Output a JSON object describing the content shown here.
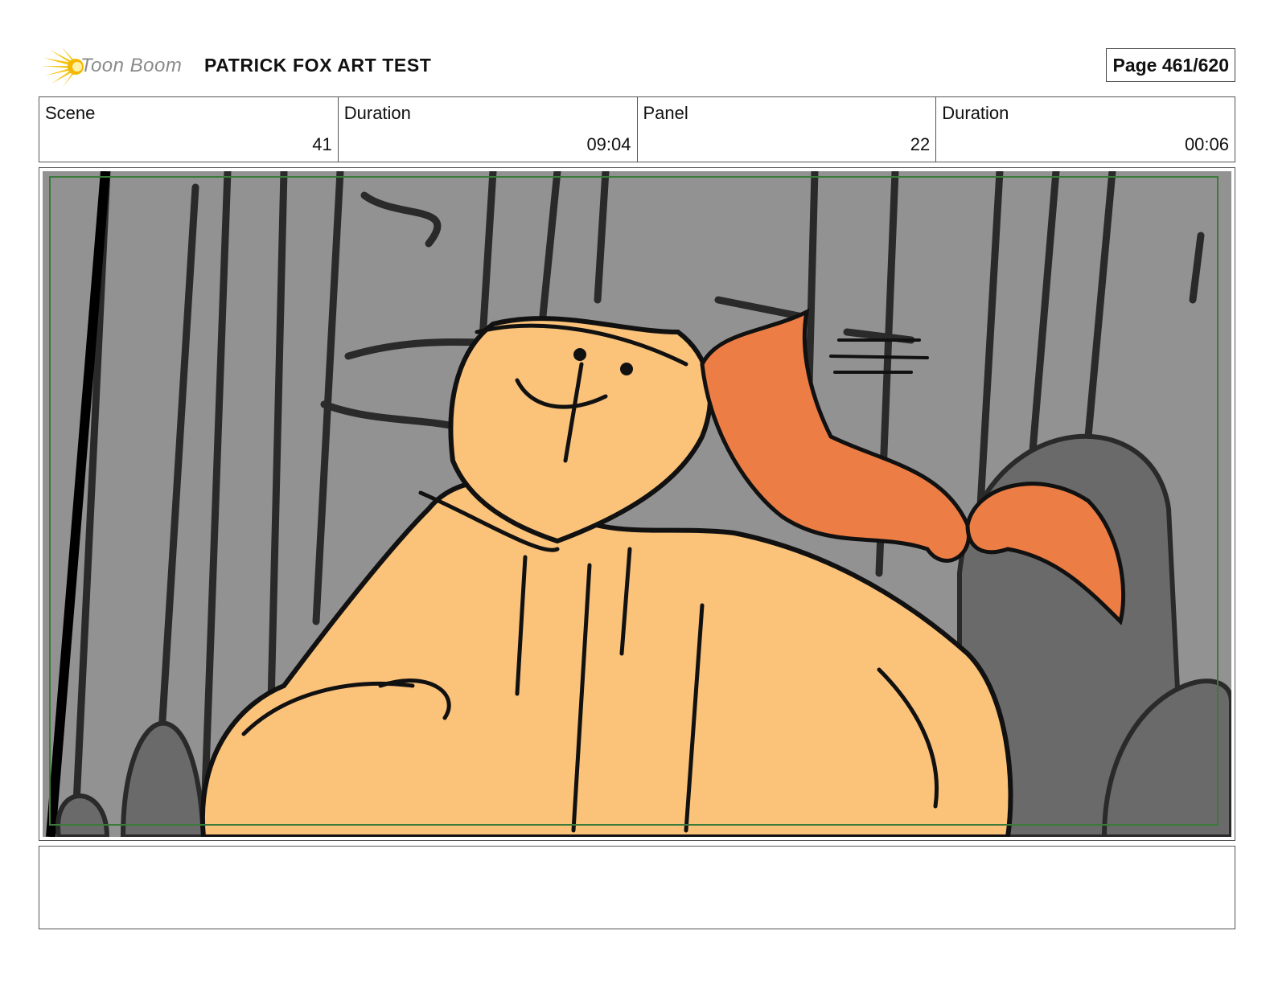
{
  "header": {
    "logo_text": "Toon Boom",
    "project_title": "PATRICK FOX ART TEST",
    "page_label": "Page 461/620"
  },
  "info": {
    "cells": [
      {
        "label": "Scene",
        "value": "41"
      },
      {
        "label": "Duration",
        "value": "09:04"
      },
      {
        "label": "Panel",
        "value": "22"
      },
      {
        "label": "Duration",
        "value": "00:06"
      }
    ]
  },
  "panel": {
    "caption": ""
  },
  "colors": {
    "background_gray": "#929292",
    "dark_gray": "#6a6a6a",
    "hoodie": "#fbc27a",
    "fox": "#ec7d45",
    "safe_frame": "#3a7a3a",
    "logo_yellow": "#f5c518"
  }
}
